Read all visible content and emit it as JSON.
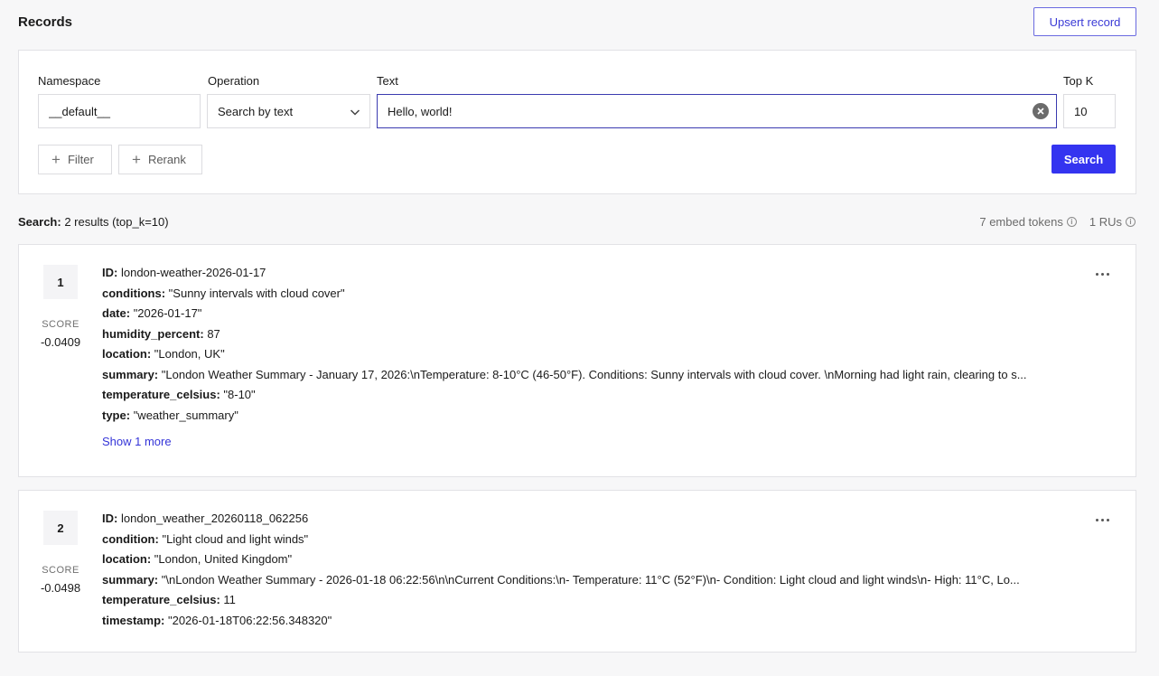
{
  "page": {
    "title": "Records"
  },
  "toolbar": {
    "upsert_label": "Upsert record"
  },
  "search": {
    "namespace_label": "Namespace",
    "namespace_value": "__default__",
    "operation_label": "Operation",
    "operation_value": "Search by text",
    "text_label": "Text",
    "text_value": "Hello, world!",
    "topk_label": "Top K",
    "topk_value": "10",
    "filter_label": "Filter",
    "rerank_label": "Rerank",
    "search_label": "Search"
  },
  "summary": {
    "prefix": "Search:",
    "text": "2 results (top_k=10)",
    "embed_tokens": "7 embed tokens",
    "rus": "1 RUs"
  },
  "results": [
    {
      "rank": "1",
      "score_label": "SCORE",
      "score": "-0.0409",
      "fields": [
        {
          "key": "ID:",
          "value": "london-weather-2026-01-17"
        },
        {
          "key": "conditions:",
          "value": "\"Sunny intervals with cloud cover\""
        },
        {
          "key": "date:",
          "value": "\"2026-01-17\""
        },
        {
          "key": "humidity_percent:",
          "value": "87"
        },
        {
          "key": "location:",
          "value": "\"London, UK\""
        },
        {
          "key": "summary:",
          "value": "\"London Weather Summary - January 17, 2026:\\nTemperature: 8-10°C (46-50°F). Conditions: Sunny intervals with cloud cover. \\nMorning had light rain, clearing to s..."
        },
        {
          "key": "temperature_celsius:",
          "value": "\"8-10\""
        },
        {
          "key": "type:",
          "value": "\"weather_summary\""
        }
      ],
      "show_more": "Show 1 more"
    },
    {
      "rank": "2",
      "score_label": "SCORE",
      "score": "-0.0498",
      "fields": [
        {
          "key": "ID:",
          "value": "london_weather_20260118_062256"
        },
        {
          "key": "condition:",
          "value": "\"Light cloud and light winds\""
        },
        {
          "key": "location:",
          "value": "\"London, United Kingdom\""
        },
        {
          "key": "summary:",
          "value": "\"\\nLondon Weather Summary - 2026-01-18 06:22:56\\n\\nCurrent Conditions:\\n- Temperature: 11°C (52°F)\\n- Condition: Light cloud and light winds\\n- High: 11°C, Lo..."
        },
        {
          "key": "temperature_celsius:",
          "value": "11"
        },
        {
          "key": "timestamp:",
          "value": "\"2026-01-18T06:22:56.348320\""
        }
      ]
    }
  ]
}
